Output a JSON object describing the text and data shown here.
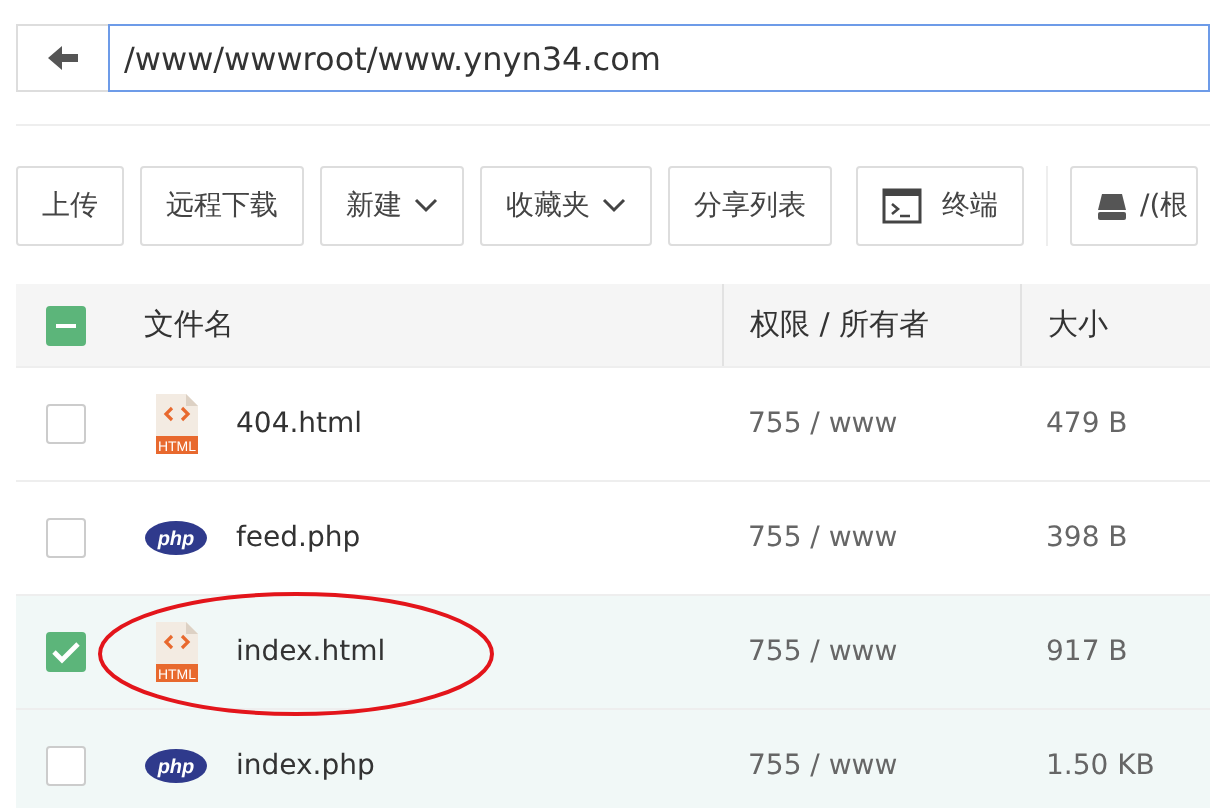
{
  "address_bar": {
    "path": "/www/wwwroot/www.ynyn34.com"
  },
  "toolbar": [
    {
      "label": "上传",
      "kind": "plain"
    },
    {
      "label": "远程下载",
      "kind": "plain"
    },
    {
      "label": "新建",
      "kind": "dropdown"
    },
    {
      "label": "收藏夹",
      "kind": "dropdown"
    },
    {
      "label": "分享列表",
      "kind": "plain"
    },
    {
      "label": "终端",
      "kind": "terminal"
    },
    {
      "label": "/(根",
      "kind": "disk"
    }
  ],
  "table": {
    "select_all": {
      "partial": true
    },
    "columns": [
      "文件名",
      "权限 / 所有者",
      "大小"
    ],
    "rows": [
      {
        "kind": "html",
        "icon_text": "HTML",
        "name": "404.html",
        "permission": "755 / www",
        "size": "479 B",
        "selected": false,
        "highlighted": false,
        "circled": false
      },
      {
        "kind": "php",
        "icon_text": "php",
        "name": "feed.php",
        "permission": "755 / www",
        "size": "398 B",
        "selected": false,
        "highlighted": false,
        "circled": false
      },
      {
        "kind": "html",
        "icon_text": "HTML",
        "name": "index.html",
        "permission": "755 / www",
        "size": "917 B",
        "selected": true,
        "highlighted": true,
        "circled": true
      },
      {
        "kind": "php",
        "icon_text": "php",
        "name": "index.php",
        "permission": "755 / www",
        "size": "1.50 KB",
        "selected": false,
        "highlighted": true,
        "circled": false
      }
    ]
  }
}
